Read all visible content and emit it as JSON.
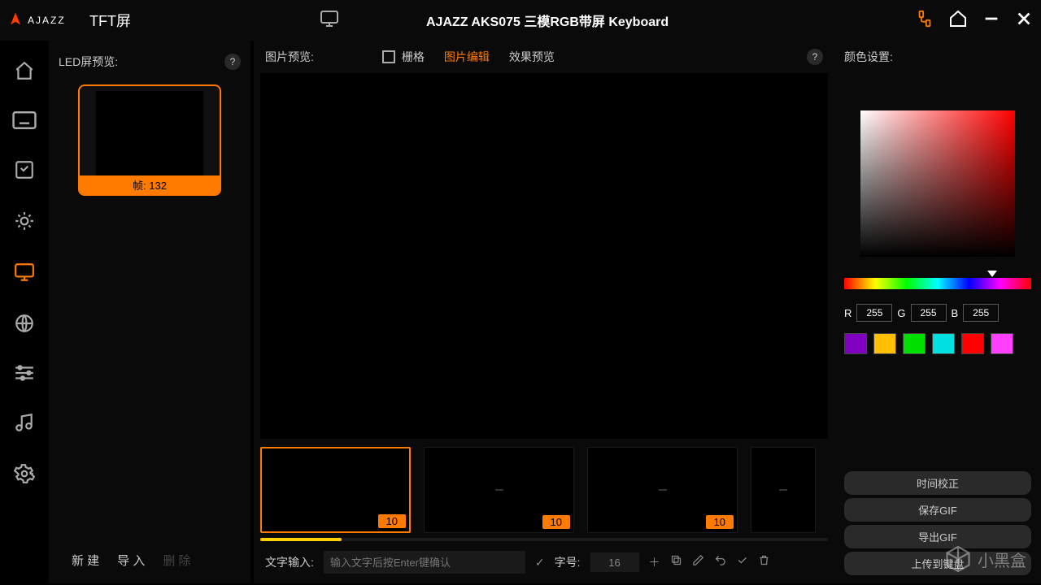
{
  "titlebar": {
    "brand": "AJAZZ",
    "section": "TFT屏",
    "app_title": "AJAZZ AKS075 三模RGB带屏 Keyboard"
  },
  "sidebar": {
    "items": [
      "home",
      "keyboard",
      "code",
      "brightness",
      "monitor",
      "globe",
      "equalizer",
      "music",
      "settings"
    ],
    "active_index": 4
  },
  "led_panel": {
    "title": "LED屏预览:",
    "frame_prefix": "帧: ",
    "frame_count": "132",
    "buttons": {
      "new": "新 建",
      "import": "导 入",
      "delete": "删 除"
    }
  },
  "editor": {
    "preview_label": "图片预览:",
    "grid_label": "栅格",
    "tab_edit": "图片编辑",
    "tab_effect": "效果预览"
  },
  "frames": {
    "durations": [
      "10",
      "10",
      "10"
    ]
  },
  "textbar": {
    "label": "文字输入:",
    "placeholder": "输入文字后按Enter键确认",
    "font_label": "字号:",
    "font_size": "16"
  },
  "color_panel": {
    "title": "颜色设置:",
    "r_label": "R",
    "g_label": "G",
    "b_label": "B",
    "r": "255",
    "g": "255",
    "b": "255",
    "swatches": [
      "#8000c0",
      "#ffc000",
      "#00e000",
      "#00e0e0",
      "#ff0000",
      "#ff40ff"
    ]
  },
  "actions": {
    "time_adjust": "时间校正",
    "save_gif": "保存GIF",
    "export_gif": "导出GIF",
    "upload": "上传到键盘"
  },
  "watermark": "小黑盒"
}
